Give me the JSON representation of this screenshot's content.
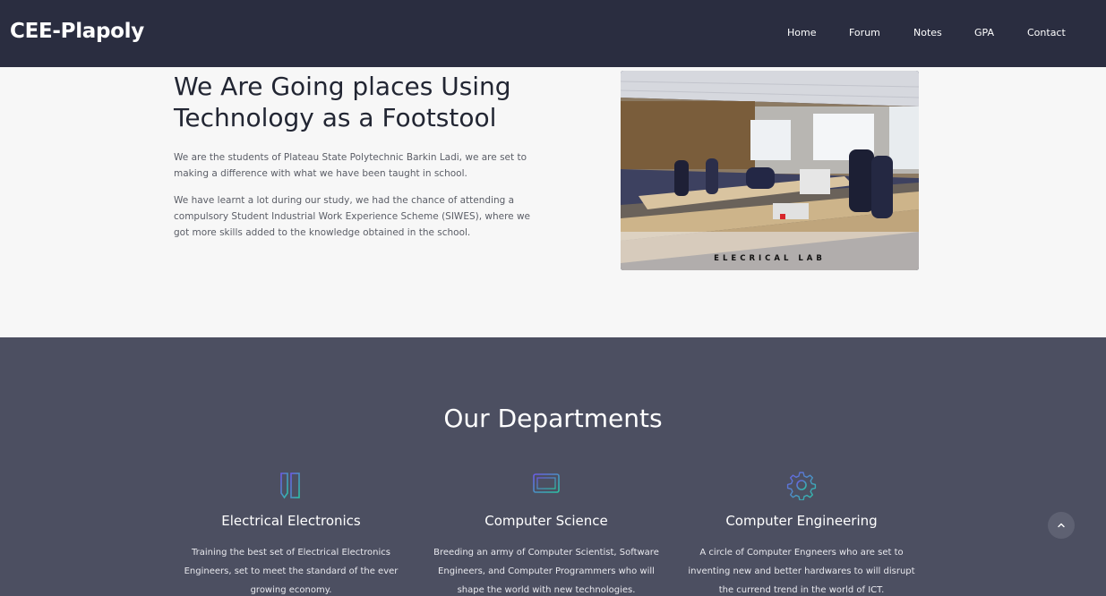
{
  "navbar": {
    "brand": "CEE-Plapoly",
    "links": [
      "Home",
      "Forum",
      "Notes",
      "GPA",
      "Contact"
    ]
  },
  "hero": {
    "title": "We Are Going places Using Technology as a Footstool",
    "paragraph_1": "We are the students of Plateau State Polytechnic Barkin Ladi, we are set to making a difference with what we have been taught in school.",
    "paragraph_2": "We have learnt a lot during our study, we had the chance of attending a compulsory Student Industrial Work Experience Scheme (SIWES), where we got more skills added to the knowledge obtained in the school.",
    "image_caption": "ELECRICAL LAB"
  },
  "departments": {
    "heading": "Our Departments",
    "items": [
      {
        "icon": "ruler-pencil-icon",
        "title": "Electrical Electronics",
        "description": "Training the best set of Electrical Electronics Engineers, set to meet the standard of the ever growing economy."
      },
      {
        "icon": "monitor-icon",
        "title": "Computer Science",
        "description": "Breeding an army of Computer Scientist, Software Engineers, and Computer Programmers who will shape the world with new technologies."
      },
      {
        "icon": "gear-icon",
        "title": "Computer Engineering",
        "description": "A circle of Computer Engneers who are set to inventing new and better hardwares to will disrupt the currend trend in the world of ICT."
      }
    ]
  },
  "scroll_top": {
    "icon": "chevron-up-icon"
  },
  "colors": {
    "navbar_bg": "#2a2d40",
    "hero_bg": "#f7f7f7",
    "departments_bg": "#4c4f61",
    "icon_gradient_start": "#6c5ce7",
    "icon_gradient_end": "#2bc4a4"
  }
}
